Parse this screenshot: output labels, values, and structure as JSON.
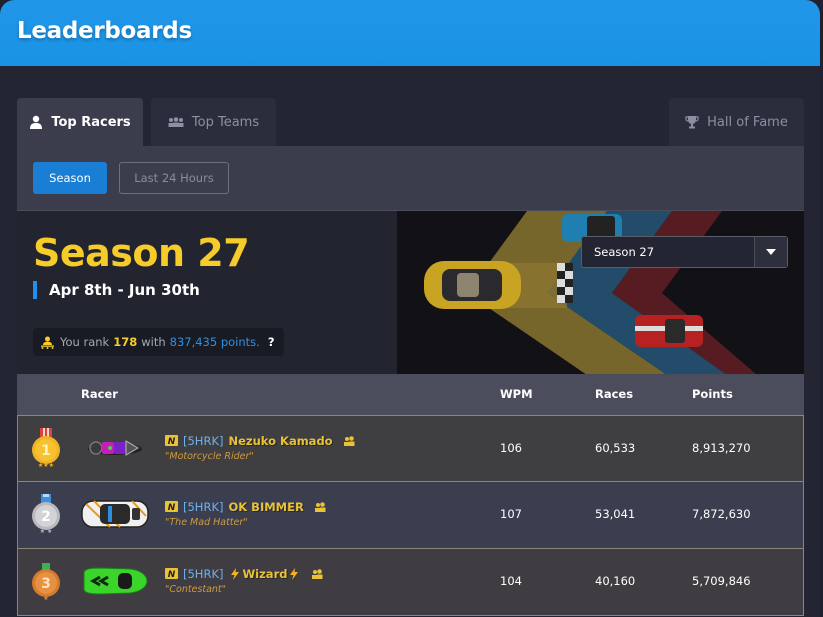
{
  "header": {
    "title": "Leaderboards"
  },
  "tabs": [
    {
      "label": "Top Racers",
      "icon": "user-icon",
      "active": true
    },
    {
      "label": "Top Teams",
      "icon": "team-icon",
      "active": false
    },
    {
      "label": "Hall of Fame",
      "icon": "trophy-icon",
      "active": false
    }
  ],
  "filters": {
    "season_label": "Season",
    "last24_label": "Last 24 Hours",
    "active": "Season"
  },
  "banner": {
    "title": "Season 27",
    "dates": "Apr 8th - Jun 30th",
    "rank": {
      "prefix": "You rank",
      "position": "178",
      "middle": "with",
      "points": "837,435 points.",
      "help": "?"
    },
    "season_select": {
      "value": "Season 27"
    }
  },
  "colors": {
    "accent_blue": "#1a93e6",
    "gold": "#f5cc2a",
    "link_blue": "#2f8fe0"
  },
  "table": {
    "headers": {
      "racer": "Racer",
      "wpm": "WPM",
      "races": "Races",
      "points": "Points"
    },
    "rows": [
      {
        "rank": "1",
        "medal": "gold",
        "tag": "[5HRK]",
        "name": "Nezuko Kamado",
        "title": "\"Motorcycle Rider\"",
        "wpm": "106",
        "races": "60,533",
        "points": "8,913,270",
        "car": "purple-motorcycle"
      },
      {
        "rank": "2",
        "medal": "silver",
        "tag": "[5HRK]",
        "name": "OK BIMMER",
        "title": "\"The Mad Hatter\"",
        "wpm": "107",
        "races": "53,041",
        "points": "7,872,630",
        "car": "white-sports-car"
      },
      {
        "rank": "3",
        "medal": "bronze",
        "tag": "[5HRK]",
        "name": "Wizard",
        "title": "\"Contestant\"",
        "wpm": "104",
        "races": "40,160",
        "points": "5,709,846",
        "car": "green-supercar"
      }
    ]
  }
}
